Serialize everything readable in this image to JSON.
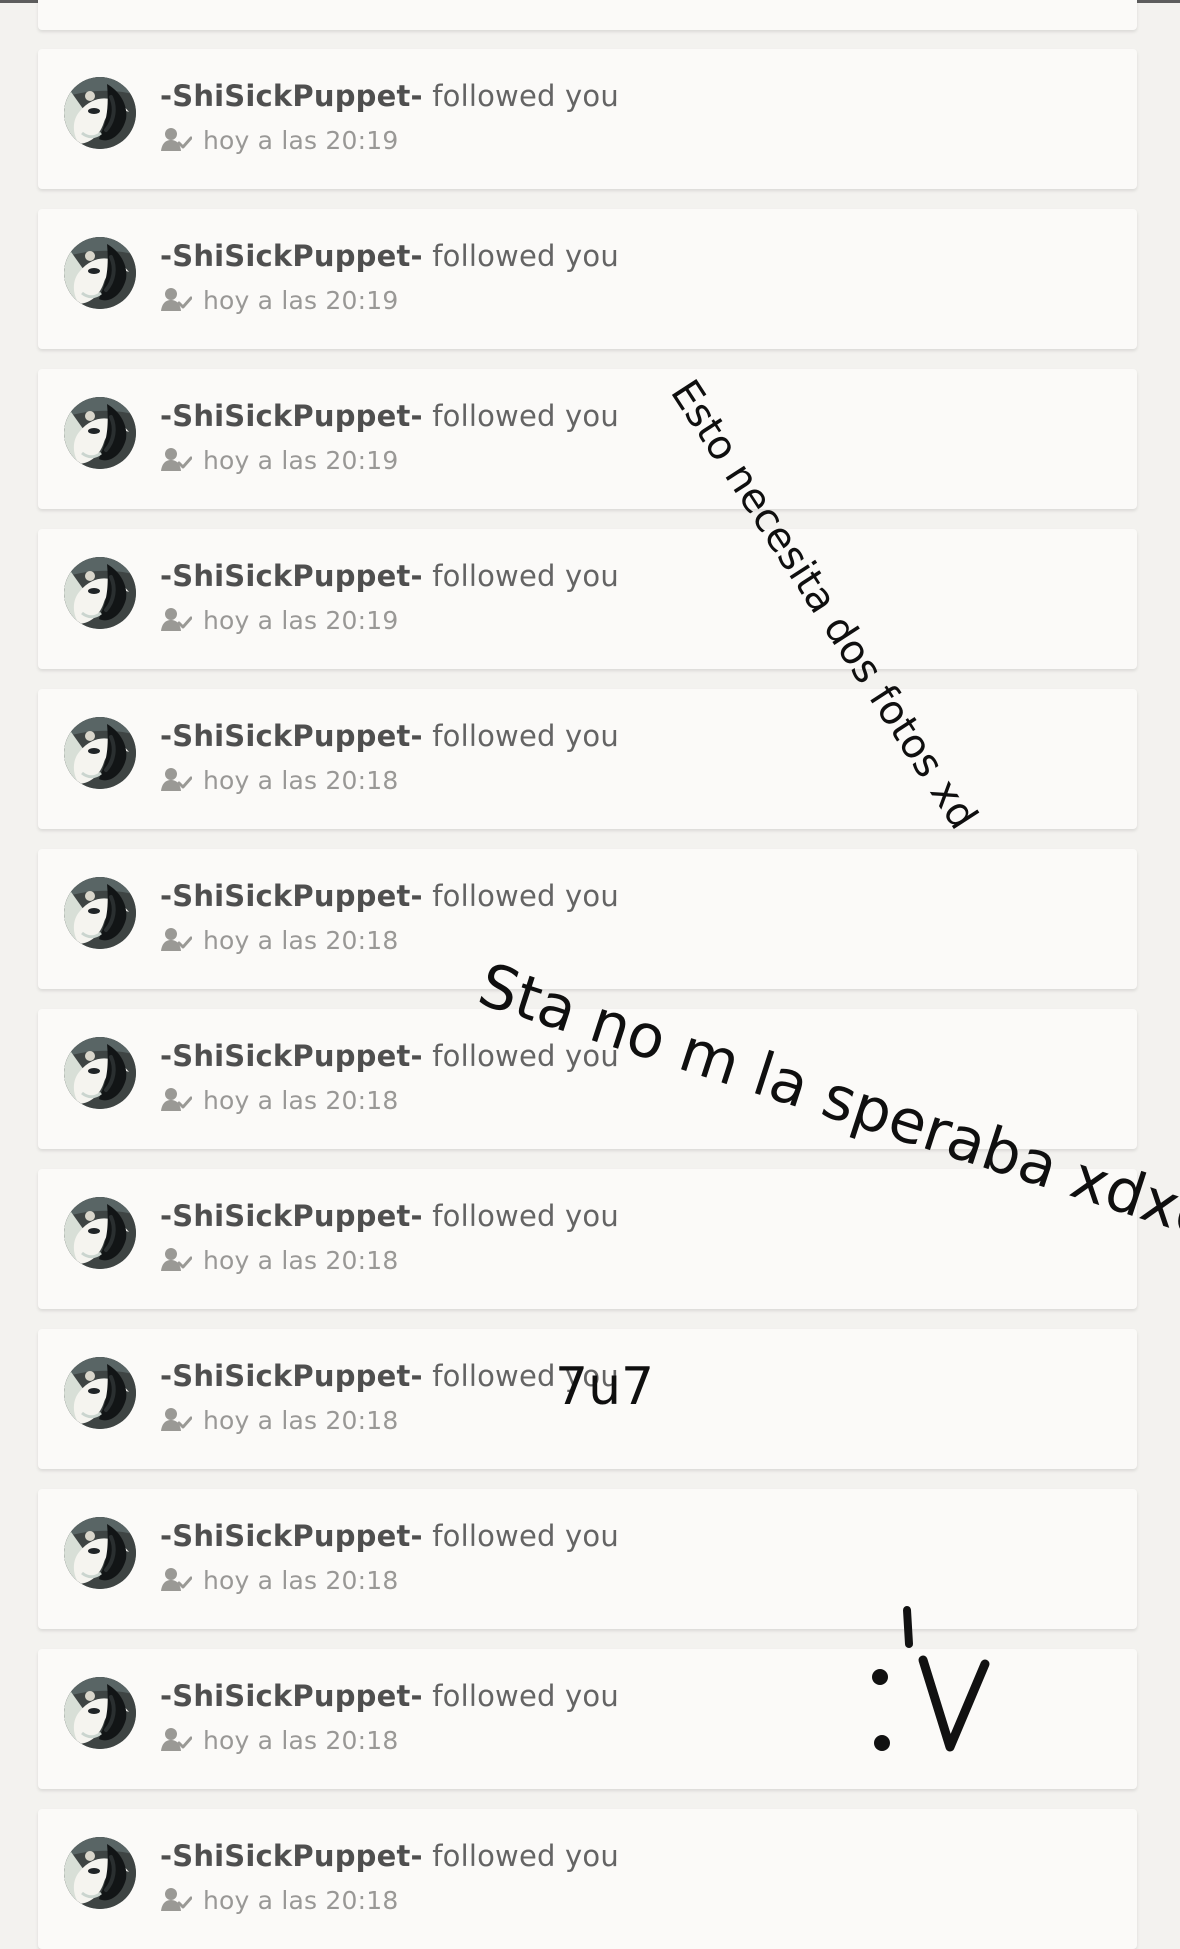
{
  "theme": {
    "background": "#f3f2ef",
    "card": "#fbfaf8",
    "primary_text": "#4f4f4f",
    "secondary_text": "#999896",
    "ink": "#0f0f0f"
  },
  "notifications": [
    {
      "username": "-ShiSickPuppet-",
      "action": "followed you",
      "time": "hoy a las 20:19",
      "icon": "follow-user-icon"
    },
    {
      "username": "-ShiSickPuppet-",
      "action": "followed you",
      "time": "hoy a las 20:19",
      "icon": "follow-user-icon"
    },
    {
      "username": "-ShiSickPuppet-",
      "action": "followed you",
      "time": "hoy a las 20:19",
      "icon": "follow-user-icon"
    },
    {
      "username": "-ShiSickPuppet-",
      "action": "followed you",
      "time": "hoy a las 20:19",
      "icon": "follow-user-icon"
    },
    {
      "username": "-ShiSickPuppet-",
      "action": "followed you",
      "time": "hoy a las 20:18",
      "icon": "follow-user-icon"
    },
    {
      "username": "-ShiSickPuppet-",
      "action": "followed you",
      "time": "hoy a las 20:18",
      "icon": "follow-user-icon"
    },
    {
      "username": "-ShiSickPuppet-",
      "action": "followed you",
      "time": "hoy a las 20:18",
      "icon": "follow-user-icon"
    },
    {
      "username": "-ShiSickPuppet-",
      "action": "followed you",
      "time": "hoy a las 20:18",
      "icon": "follow-user-icon"
    },
    {
      "username": "-ShiSickPuppet-",
      "action": "followed you",
      "time": "hoy a las 20:18",
      "icon": "follow-user-icon"
    },
    {
      "username": "-ShiSickPuppet-",
      "action": "followed you",
      "time": "hoy a las 20:18",
      "icon": "follow-user-icon"
    },
    {
      "username": "-ShiSickPuppet-",
      "action": "followed you",
      "time": "hoy a las 20:18",
      "icon": "follow-user-icon"
    },
    {
      "username": "-ShiSickPuppet-",
      "action": "followed you",
      "time": "hoy a las 20:18",
      "icon": "follow-user-icon"
    }
  ],
  "annotations": {
    "note_1": "Esto necesita dos fotos xd",
    "note_2": "Sta no m la speraba xdxd",
    "note_3": "7u7",
    "note_4": ":V"
  }
}
